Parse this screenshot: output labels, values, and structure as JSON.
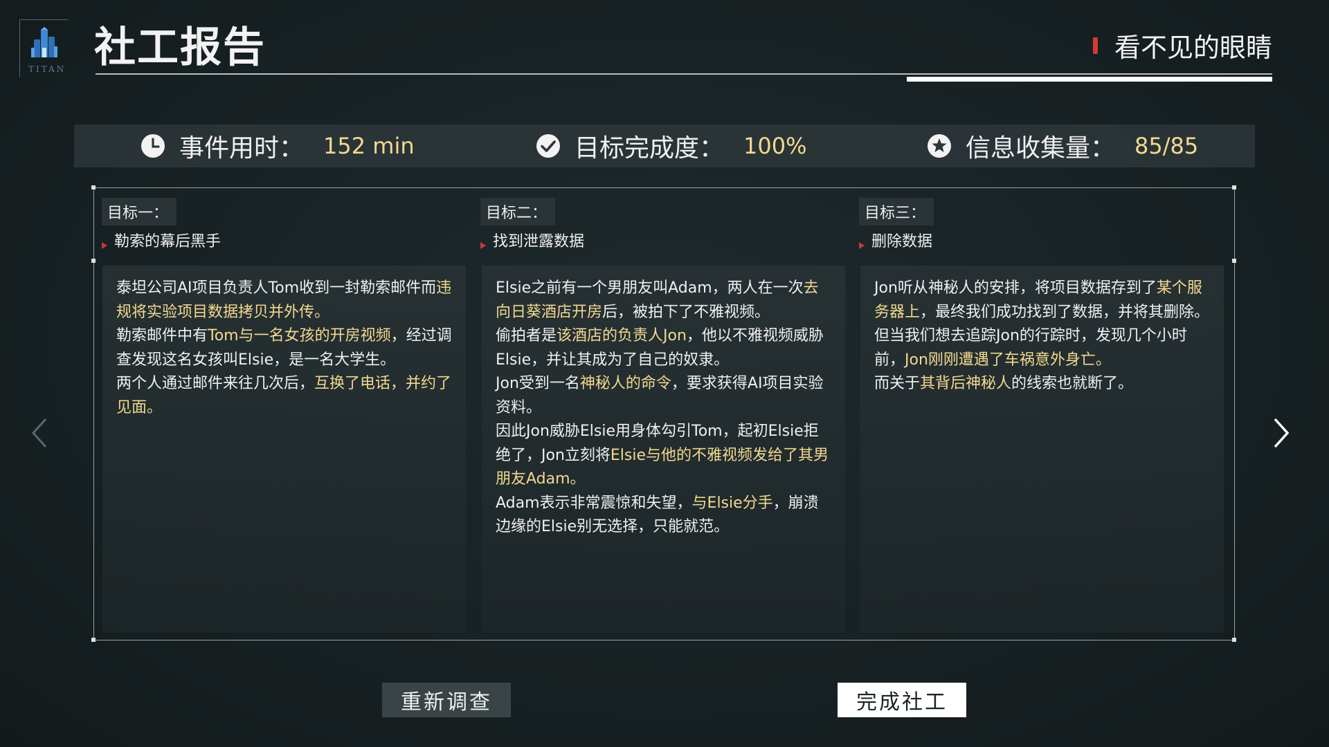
{
  "header": {
    "logo_text": "TITAN",
    "title": "社工报告",
    "case_name": "看不见的眼睛"
  },
  "stats": [
    {
      "icon": "clock-icon",
      "label": "事件用时：",
      "value": "152 min"
    },
    {
      "icon": "check-circle-icon",
      "label": "目标完成度：",
      "value": "100%"
    },
    {
      "icon": "star-circle-icon",
      "label": "信息收集量：",
      "value": "85/85"
    }
  ],
  "goals": [
    {
      "tag": "目标一：",
      "name": "勒索的幕后黑手",
      "text": [
        {
          "t": "泰坦公司AI项目负责人Tom收到一封勒索邮件而",
          "h": false
        },
        {
          "t": "违规将实验项目数据拷贝并外传。",
          "h": true
        },
        {
          "t": "\n勒索邮件中有",
          "h": false
        },
        {
          "t": "Tom与一名女孩的开房视频",
          "h": true
        },
        {
          "t": "，经过调查发现这名女孩叫Elsie，是一名大学生。\n两个人通过邮件来往几次后，",
          "h": false
        },
        {
          "t": "互换了电话，并约了见面。",
          "h": true
        }
      ]
    },
    {
      "tag": "目标二：",
      "name": "找到泄露数据",
      "text": [
        {
          "t": "Elsie之前有一个男朋友叫Adam，两人在一次",
          "h": false
        },
        {
          "t": "去向日葵酒店开房",
          "h": true
        },
        {
          "t": "后，被拍下了不雅视频。\n偷拍者是",
          "h": false
        },
        {
          "t": "该酒店的负责人Jon",
          "h": true
        },
        {
          "t": "，他以不雅视频威胁Elsie，并让其成为了自己的奴隶。\nJon受到一名",
          "h": false
        },
        {
          "t": "神秘人的命令",
          "h": true
        },
        {
          "t": "，要求获得AI项目实验资料。\n因此Jon威胁Elsie用身体勾引Tom，起初Elsie拒绝了，Jon立刻将",
          "h": false
        },
        {
          "t": "Elsie与他的不雅视频发给了其男朋友Adam。",
          "h": true
        },
        {
          "t": "\nAdam表示非常震惊和失望，",
          "h": false
        },
        {
          "t": "与Elsie分手",
          "h": true
        },
        {
          "t": "，崩溃边缘的Elsie别无选择，只能就范。",
          "h": false
        }
      ]
    },
    {
      "tag": "目标三：",
      "name": "删除数据",
      "text": [
        {
          "t": "Jon听从神秘人的安排，将项目数据存到了",
          "h": false
        },
        {
          "t": "某个服务器上",
          "h": true
        },
        {
          "t": "，最终我们成功找到了数据，并将其删除。\n但当我们想去追踪Jon的行踪时，发现几个小时前，",
          "h": false
        },
        {
          "t": "Jon刚刚遭遇了车祸意外身亡。",
          "h": true
        },
        {
          "t": "\n而关于",
          "h": false
        },
        {
          "t": "其背后神秘人",
          "h": true
        },
        {
          "t": "的线索也就断了。",
          "h": false
        }
      ]
    }
  ],
  "buttons": {
    "retry_label": "重新调查",
    "finish_label": "完成社工"
  },
  "nav": {
    "prev_icon": "chevron-left-icon",
    "next_icon": "chevron-right-icon"
  },
  "colors": {
    "highlight": "#f2d990",
    "marker": "#d93838",
    "background": "#182123"
  }
}
